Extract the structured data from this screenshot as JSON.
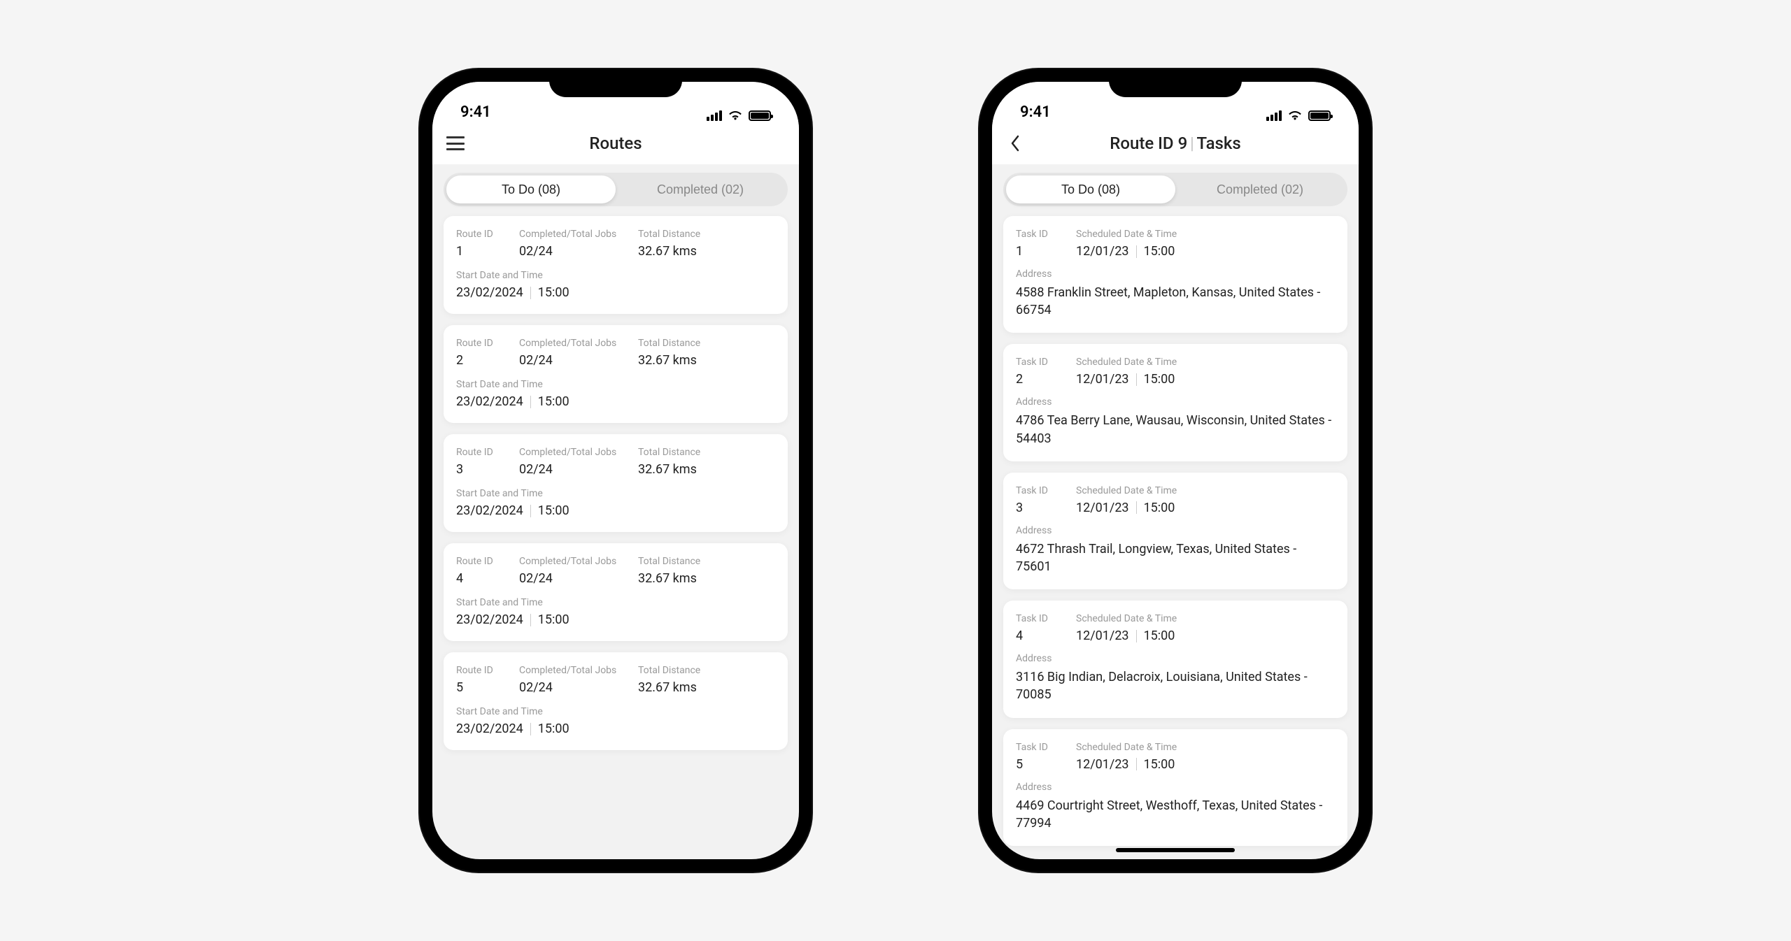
{
  "status": {
    "time": "9:41"
  },
  "left": {
    "header": {
      "title": "Routes"
    },
    "tabs": {
      "todo": "To Do (08)",
      "completed": "Completed (02)"
    },
    "labels": {
      "routeId": "Route ID",
      "completedTotal": "Completed/Total Jobs",
      "totalDistance": "Total Distance",
      "startDateTime": "Start Date and Time"
    },
    "routes": [
      {
        "id": "1",
        "jobs": "02/24",
        "distance": "32.67 kms",
        "date": "23/02/2024",
        "time": "15:00"
      },
      {
        "id": "2",
        "jobs": "02/24",
        "distance": "32.67 kms",
        "date": "23/02/2024",
        "time": "15:00"
      },
      {
        "id": "3",
        "jobs": "02/24",
        "distance": "32.67 kms",
        "date": "23/02/2024",
        "time": "15:00"
      },
      {
        "id": "4",
        "jobs": "02/24",
        "distance": "32.67 kms",
        "date": "23/02/2024",
        "time": "15:00"
      },
      {
        "id": "5",
        "jobs": "02/24",
        "distance": "32.67 kms",
        "date": "23/02/2024",
        "time": "15:00"
      }
    ]
  },
  "right": {
    "header": {
      "titleLeft": "Route ID 9",
      "titleRight": "Tasks"
    },
    "tabs": {
      "todo": "To Do (08)",
      "completed": "Completed (02)"
    },
    "labels": {
      "taskId": "Task ID",
      "scheduled": "Scheduled Date & Time",
      "address": "Address"
    },
    "tasks": [
      {
        "id": "1",
        "date": "12/01/23",
        "time": "15:00",
        "address": "4588 Franklin Street, Mapleton, Kansas, United States - 66754"
      },
      {
        "id": "2",
        "date": "12/01/23",
        "time": "15:00",
        "address": "4786 Tea Berry Lane, Wausau, Wisconsin, United States - 54403"
      },
      {
        "id": "3",
        "date": "12/01/23",
        "time": "15:00",
        "address": "4672 Thrash Trail, Longview,  Texas,  United States - 75601"
      },
      {
        "id": "4",
        "date": "12/01/23",
        "time": "15:00",
        "address": "3116 Big Indian, Delacroix,  Louisiana, United States - 70085"
      },
      {
        "id": "5",
        "date": "12/01/23",
        "time": "15:00",
        "address": "4469 Courtright Street, Westhoff, Texas,  United States - 77994"
      }
    ]
  }
}
